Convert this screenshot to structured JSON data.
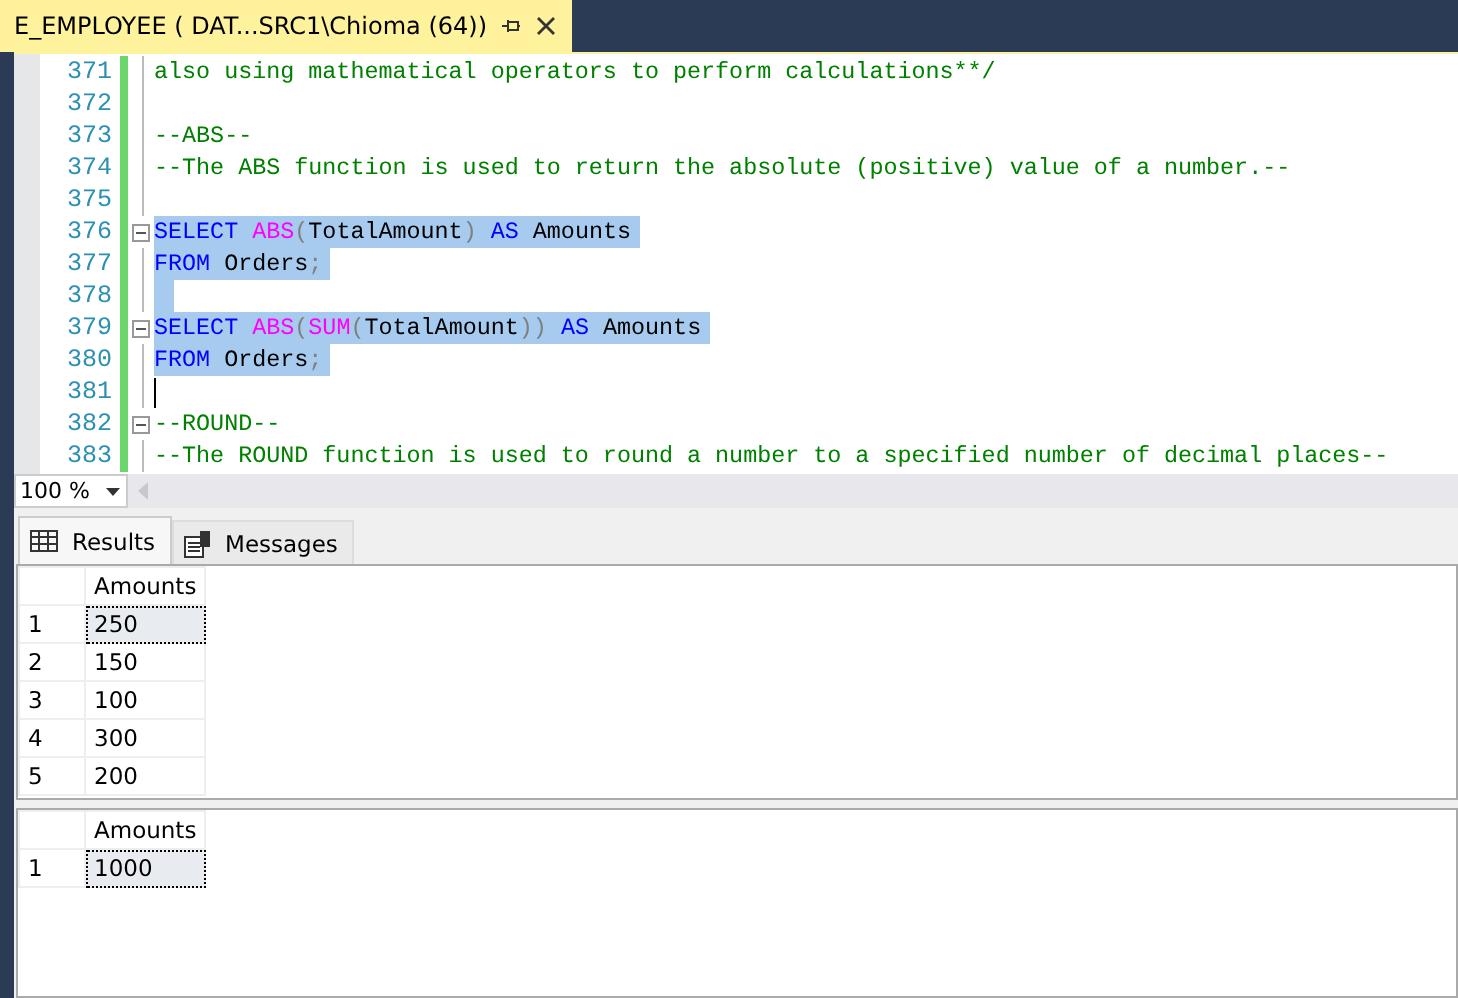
{
  "document_tab": {
    "title": "E_EMPLOYEE ( DAT...SRC1\\Chioma (64))"
  },
  "editor": {
    "lines": [
      {
        "number": "371",
        "selected": false,
        "fold": false,
        "cursor": false,
        "tokens": [
          {
            "kind": "comment",
            "text": "also using mathematical operators to perform calculations**/"
          }
        ]
      },
      {
        "number": "372",
        "selected": false,
        "fold": false,
        "cursor": false
      },
      {
        "number": "373",
        "selected": false,
        "fold": false,
        "cursor": false,
        "tokens": [
          {
            "kind": "comment",
            "text": "--ABS--"
          }
        ]
      },
      {
        "number": "374",
        "selected": false,
        "fold": false,
        "cursor": false,
        "tokens": [
          {
            "kind": "comment",
            "text": "--The ABS function is used to return the absolute (positive) value of a number.--"
          }
        ]
      },
      {
        "number": "375",
        "selected": false,
        "fold": false,
        "cursor": false
      },
      {
        "number": "376",
        "selected": true,
        "fold": true,
        "cursor": false,
        "tokens": [
          {
            "kind": "keyword",
            "text": "SELECT "
          },
          {
            "kind": "function",
            "text": "ABS"
          },
          {
            "kind": "punct",
            "text": "("
          },
          {
            "kind": "plain",
            "text": "TotalAmount"
          },
          {
            "kind": "punct",
            "text": ") "
          },
          {
            "kind": "keyword",
            "text": "AS "
          },
          {
            "kind": "plain",
            "text": "Amounts"
          }
        ]
      },
      {
        "number": "377",
        "selected": true,
        "fold": false,
        "cursor": false,
        "tokens": [
          {
            "kind": "keyword",
            "text": "FROM "
          },
          {
            "kind": "plain",
            "text": "Orders"
          },
          {
            "kind": "punct",
            "text": ";"
          }
        ]
      },
      {
        "number": "378",
        "selected": true,
        "fold": false,
        "cursor": false
      },
      {
        "number": "379",
        "selected": true,
        "fold": true,
        "cursor": false,
        "tokens": [
          {
            "kind": "keyword",
            "text": "SELECT "
          },
          {
            "kind": "function",
            "text": "ABS"
          },
          {
            "kind": "punct",
            "text": "("
          },
          {
            "kind": "function",
            "text": "SUM"
          },
          {
            "kind": "punct",
            "text": "("
          },
          {
            "kind": "plain",
            "text": "TotalAmount"
          },
          {
            "kind": "punct",
            "text": ")) "
          },
          {
            "kind": "keyword",
            "text": "AS "
          },
          {
            "kind": "plain",
            "text": "Amounts"
          }
        ]
      },
      {
        "number": "380",
        "selected": true,
        "fold": false,
        "cursor": false,
        "tokens": [
          {
            "kind": "keyword",
            "text": "FROM "
          },
          {
            "kind": "plain",
            "text": "Orders"
          },
          {
            "kind": "punct",
            "text": ";"
          }
        ]
      },
      {
        "number": "381",
        "selected": false,
        "fold": false,
        "cursor": true
      },
      {
        "number": "382",
        "selected": false,
        "fold": true,
        "cursor": false,
        "tokens": [
          {
            "kind": "comment",
            "text": "--ROUND--"
          }
        ]
      },
      {
        "number": "383",
        "selected": false,
        "fold": false,
        "cursor": false,
        "tokens": [
          {
            "kind": "comment",
            "text": "--The ROUND function is used to round a number to a specified number of decimal places--"
          }
        ]
      }
    ]
  },
  "zoom": {
    "value": "100 %"
  },
  "result_tabs": [
    {
      "label": "Results",
      "selected": true
    },
    {
      "label": "Messages",
      "selected": false
    }
  ],
  "result_grids": [
    {
      "columns": [
        "Amounts"
      ],
      "rows": [
        {
          "number": "1",
          "cells": [
            "250"
          ],
          "selected": true
        },
        {
          "number": "2",
          "cells": [
            "150"
          ],
          "selected": false
        },
        {
          "number": "3",
          "cells": [
            "100"
          ],
          "selected": false
        },
        {
          "number": "4",
          "cells": [
            "300"
          ],
          "selected": false
        },
        {
          "number": "5",
          "cells": [
            "200"
          ],
          "selected": false
        }
      ]
    },
    {
      "columns": [
        "Amounts"
      ],
      "rows": [
        {
          "number": "1",
          "cells": [
            "1000"
          ],
          "selected": true
        }
      ]
    }
  ]
}
